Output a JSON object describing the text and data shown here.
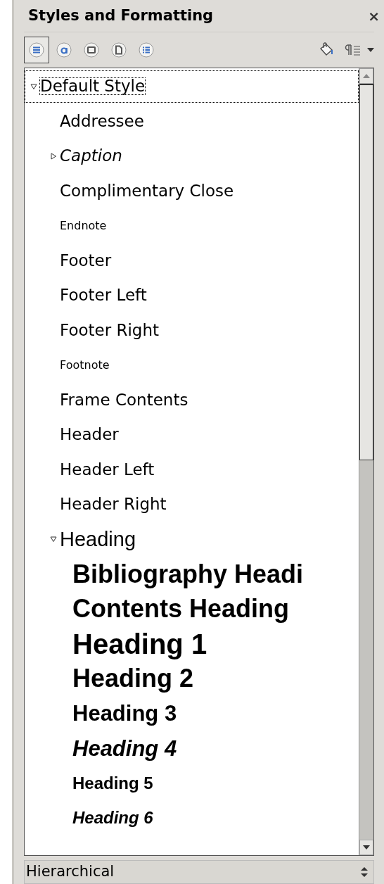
{
  "title": "Styles and Formatting",
  "close": "×",
  "families": [
    {
      "selected": true
    },
    {
      "selected": false
    },
    {
      "selected": false
    },
    {
      "selected": false
    },
    {
      "selected": false
    }
  ],
  "tree": [
    {
      "label": "Default Style",
      "kind": "normal",
      "selected": true,
      "expanded": true,
      "children": [
        {
          "label": "Addressee",
          "kind": "normal",
          "selected": false
        },
        {
          "label": "Caption",
          "kind": "italic",
          "selected": false,
          "expanded": false
        },
        {
          "label": "Complimentary Close",
          "kind": "normal",
          "selected": false
        },
        {
          "label": "Endnote",
          "kind": "small",
          "selected": false
        },
        {
          "label": "Footer",
          "kind": "normal",
          "selected": false
        },
        {
          "label": "Footer Left",
          "kind": "normal",
          "selected": false
        },
        {
          "label": "Footer Right",
          "kind": "normal",
          "selected": false
        },
        {
          "label": "Footnote",
          "kind": "small",
          "selected": false
        },
        {
          "label": "Frame Contents",
          "kind": "normal",
          "selected": false
        },
        {
          "label": "Header",
          "kind": "normal",
          "selected": false
        },
        {
          "label": "Header Left",
          "kind": "normal",
          "selected": false
        },
        {
          "label": "Header Right",
          "kind": "normal",
          "selected": false
        },
        {
          "label": "Heading",
          "kind": "heading",
          "selected": false,
          "expanded": true,
          "children": [
            {
              "label": "Bibliography Headi",
              "kind": "title",
              "selected": false
            },
            {
              "label": "Contents Heading",
              "kind": "title",
              "selected": false
            },
            {
              "label": "Heading 1",
              "kind": "h1",
              "selected": false
            },
            {
              "label": "Heading 2",
              "kind": "h2",
              "selected": false
            },
            {
              "label": "Heading 3",
              "kind": "h3",
              "selected": false
            },
            {
              "label": "Heading 4",
              "kind": "h4",
              "selected": false
            },
            {
              "label": "Heading 5",
              "kind": "h5",
              "selected": false
            },
            {
              "label": "Heading 6",
              "kind": "h6",
              "selected": false
            }
          ]
        }
      ]
    }
  ],
  "filter": {
    "value": "Hierarchical"
  }
}
